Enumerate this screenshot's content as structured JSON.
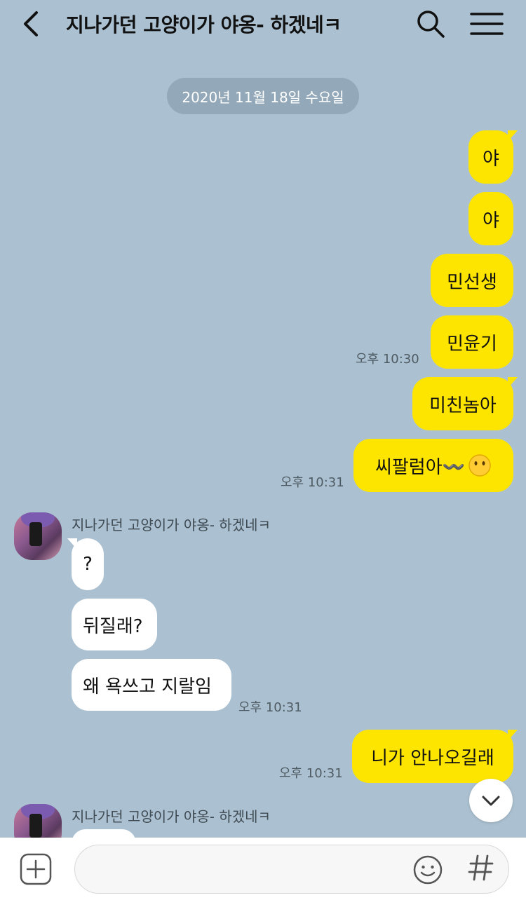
{
  "header": {
    "title": "지나가던 고양이가 야옹- 하겠네ㅋ",
    "back_icon": "chevron-left-icon",
    "search_icon": "search-icon",
    "menu_icon": "hamburger-menu-icon"
  },
  "date_divider": "2020년 11월 18일 수요일",
  "messages": {
    "m1": "야",
    "m2": "야",
    "m3": "민선생",
    "m4": "민윤기",
    "t4": "오후 10:30",
    "m5": "미친놈아",
    "m6": "씨팔럼아〰️",
    "t6": "오후 10:31",
    "sender_name": "지나가던 고양이가 야옹- 하겠네ㅋ",
    "o1": "?",
    "o2": "뒤질래?",
    "o3": "왜 욕쓰고 지랄임",
    "t_o3": "오후 10:31",
    "m7": "니가 안나오길래",
    "t7": "오후 10:31",
    "sender_name_2": "지나가던 고양이가 야옹- 하겠네ㅋ"
  },
  "input": {
    "value": "",
    "placeholder": ""
  },
  "colors": {
    "background": "#abc1d1",
    "my_bubble": "#fee500",
    "other_bubble": "#ffffff"
  }
}
